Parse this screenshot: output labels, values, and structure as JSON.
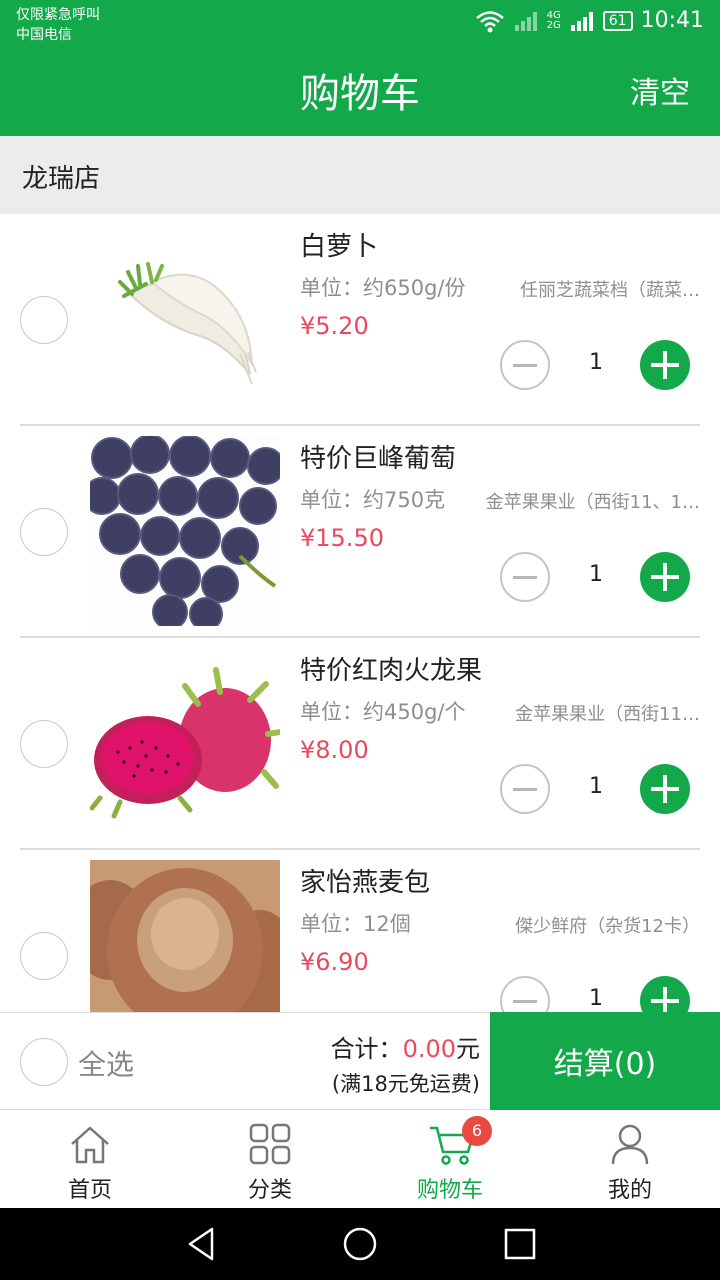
{
  "status": {
    "line1": "仅限紧急呼叫",
    "line2": "中国电信",
    "net_top": "4G",
    "net_bottom": "2G",
    "battery": "61",
    "time": "10:41"
  },
  "header": {
    "title": "购物车",
    "clear_label": "清空"
  },
  "store": {
    "name": "龙瑞店"
  },
  "items": [
    {
      "name": "白萝卜",
      "unit": "单位：约650g/份",
      "seller": "任丽芝蔬菜档（蔬菜…",
      "price": "¥5.20",
      "qty": "1",
      "image": "white-radish"
    },
    {
      "name": "特价巨峰葡萄",
      "unit": "单位：约750克",
      "seller": "金苹果果业（西街11、1…",
      "price": "¥15.50",
      "qty": "1",
      "image": "kyoho-grapes"
    },
    {
      "name": "特价红肉火龙果",
      "unit": "单位：约450g/个",
      "seller": "金苹果果业（西街11…",
      "price": "¥8.00",
      "qty": "1",
      "image": "red-dragon-fruit"
    },
    {
      "name": "家怡燕麦包",
      "unit": "单位：12個",
      "seller": "傑少鲜府（杂货12卡）",
      "price": "¥6.90",
      "qty": "1",
      "image": "oat-bread"
    }
  ],
  "footer": {
    "select_all": "全选",
    "total_label": "合计：",
    "total_amount": "0.00",
    "total_unit": "元",
    "shipping_note": "(满18元免运费)",
    "checkout_label": "结算(0)"
  },
  "tabs": [
    {
      "label": "首页",
      "icon": "home-icon"
    },
    {
      "label": "分类",
      "icon": "grid-icon"
    },
    {
      "label": "购物车",
      "icon": "cart-icon",
      "badge": "6",
      "active": true
    },
    {
      "label": "我的",
      "icon": "user-icon"
    }
  ],
  "colors": {
    "accent": "#13a84a",
    "price": "#e84a5f",
    "badge": "#e84a3f"
  }
}
